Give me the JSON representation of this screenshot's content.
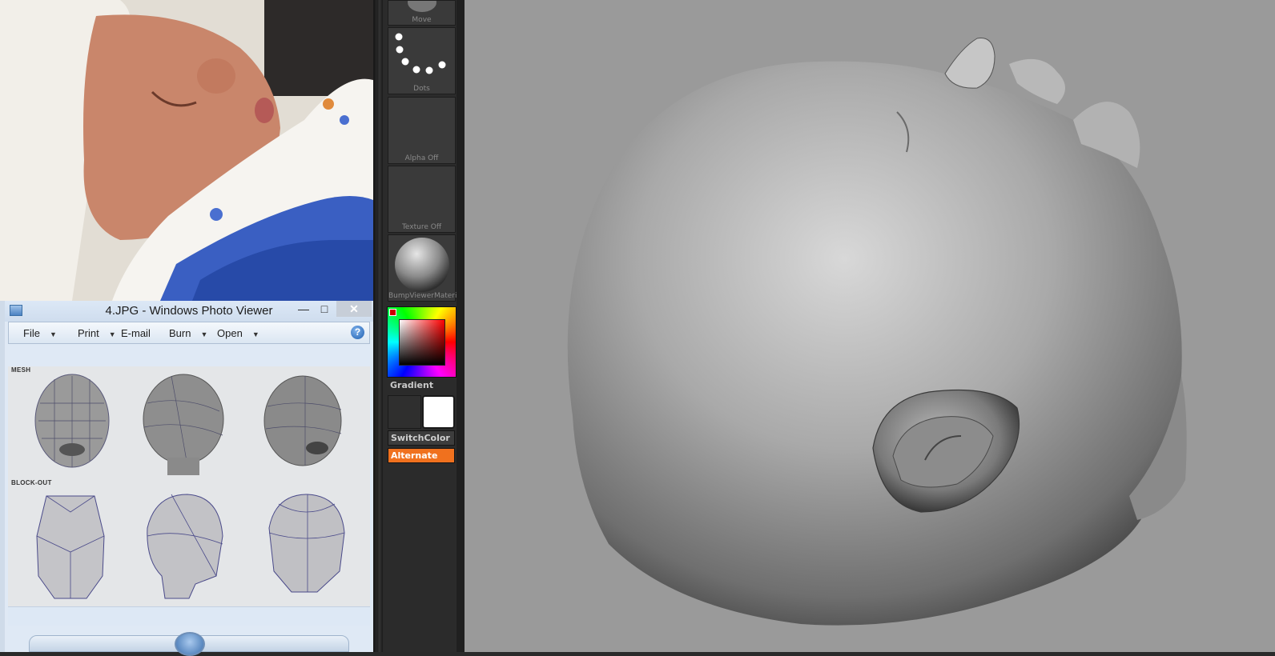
{
  "photo_viewer": {
    "title": "4.JPG - Windows Photo Viewer",
    "window_buttons": {
      "minimize": "—",
      "maximize": "□",
      "close": "✕"
    },
    "menu": [
      {
        "label": "File"
      },
      {
        "label": "Print"
      },
      {
        "label": "E-mail"
      },
      {
        "label": "Burn"
      },
      {
        "label": "Open"
      }
    ],
    "help": "?",
    "reference_sections": {
      "top": "MESH",
      "bottom": "BLOCK-OUT"
    }
  },
  "zbrush": {
    "tiles": {
      "brush": "Move",
      "stroke": "Dots",
      "alpha": "Alpha Off",
      "texture": "Texture Off",
      "material": "BumpViewerMateri"
    },
    "gradient_label": "Gradient",
    "switch_color_label": "SwitchColor",
    "alternate_label": "Alternate",
    "colors": {
      "alternate_accent": "#f0711e",
      "main_color": "#ffffff",
      "viewport_bg": "#9a9a9a"
    }
  },
  "icons": [
    "photo-viewer-app-icon",
    "help-icon",
    "caret-down-icon",
    "dots-stroke-icon",
    "sphere-material-icon"
  ]
}
